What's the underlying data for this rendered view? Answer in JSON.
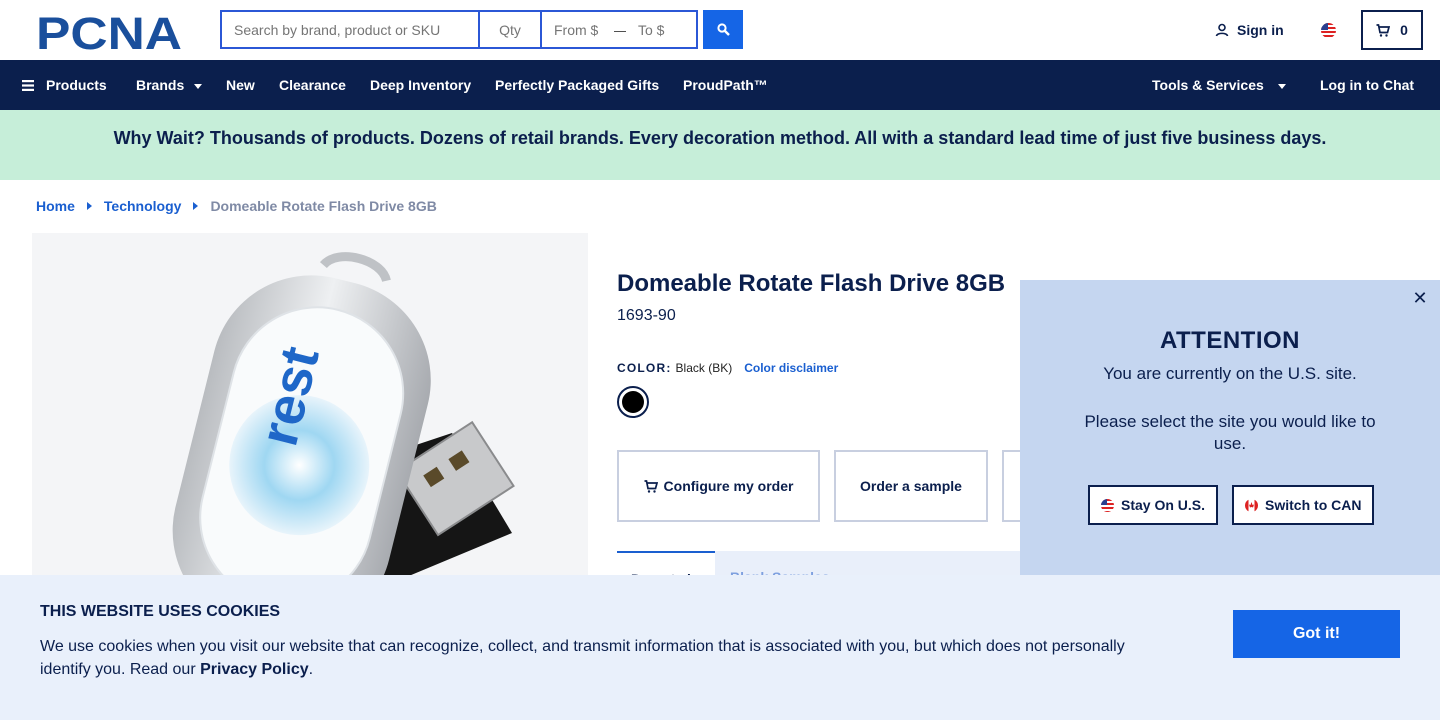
{
  "header": {
    "logo_text": "PCNA",
    "search_placeholder": "Search by brand, product or SKU",
    "qty_placeholder": "Qty",
    "from_placeholder": "From $",
    "to_placeholder": "To $",
    "price_separator": "—",
    "signin_label": "Sign in",
    "cart_count": "0",
    "search_icon": "search-icon",
    "user_icon": "user-icon",
    "cart_icon": "cart-icon"
  },
  "nav": {
    "items": [
      {
        "label": "Products"
      },
      {
        "label": "Brands"
      },
      {
        "label": "New"
      },
      {
        "label": "Clearance"
      },
      {
        "label": "Deep Inventory"
      },
      {
        "label": "Perfectly Packaged Gifts"
      },
      {
        "label": "ProudPath™"
      }
    ],
    "tools_label": "Tools & Services",
    "chat_label": "Log in to Chat"
  },
  "promo": {
    "text": "Why Wait? Thousands of products. Dozens of retail brands. Every decoration method. All with a standard lead time of just five business days."
  },
  "breadcrumb": {
    "items": [
      "Home",
      "Technology"
    ],
    "current": "Domeable Rotate Flash Drive 8GB"
  },
  "product": {
    "title": "Domeable Rotate Flash Drive 8GB",
    "sku": "1693-90",
    "color_label": "COLOR:",
    "color_value": "Black (BK)",
    "color_disclaimer": "Color disclaimer",
    "swatch_color": "#000000",
    "image_text": "rest",
    "actions": {
      "configure": "Configure my order",
      "sample": "Order a sample"
    },
    "tabs": {
      "active": "Do not al",
      "other": "Blank       Samples"
    }
  },
  "modal": {
    "heading": "ATTENTION",
    "line1": "You are currently on the U.S. site.",
    "line2": "Please select the site you would like to use.",
    "stay_label": "Stay On U.S.",
    "switch_label": "Switch to CAN",
    "close_symbol": "✕"
  },
  "cookie": {
    "title": "THIS WEBSITE USES COOKIES",
    "text": "We use cookies when you visit our website that can recognize, collect, and transmit information that is associated with you, but which does not personally identify you. Read our ",
    "link": "Privacy Policy",
    "end": ".",
    "button": "Got it!"
  },
  "colors": {
    "navy": "#0b1f4d",
    "accent_blue": "#1565e6",
    "promo_bg": "#c6eed9",
    "modal_bg": "#c5d6f0",
    "cookie_bg": "#e9f0fb"
  }
}
